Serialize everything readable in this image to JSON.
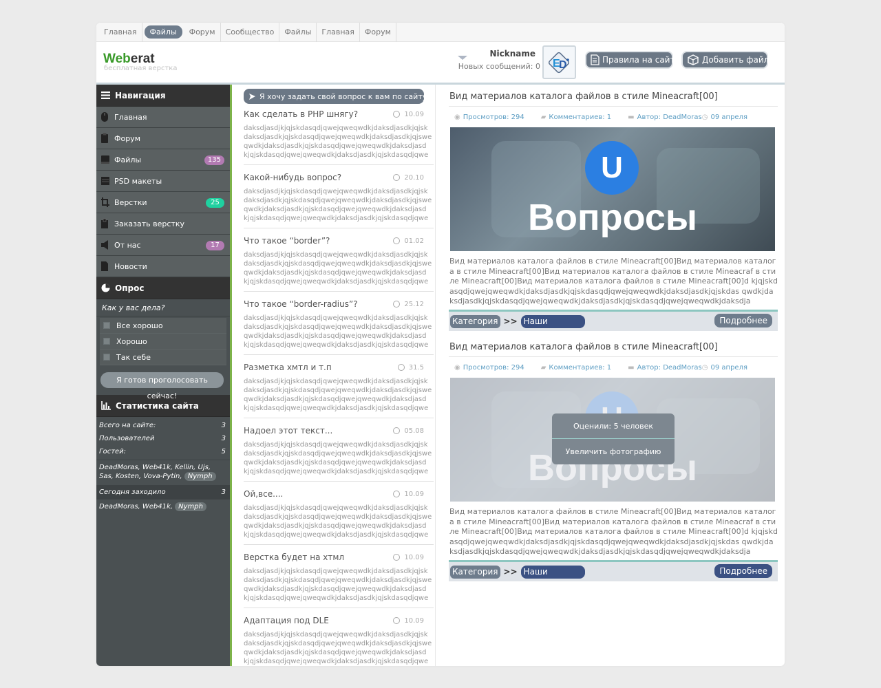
{
  "topnav": [
    "Главная",
    "Файлы",
    "Форум",
    "Сообщество",
    "Файлы",
    "Главная",
    "Форум"
  ],
  "topnav_active_index": 1,
  "logo": {
    "prefix": "Web",
    "suffix": "erat",
    "subtitle": "бесплатная верстка"
  },
  "user": {
    "nickname": "Nickname",
    "messages": "Новых сообщений: 0"
  },
  "header_buttons": {
    "rules": "Правила на сайте",
    "add_file": "Добавить файл"
  },
  "sidebar": {
    "nav_title": "Навигация",
    "items": [
      {
        "label": "Главная",
        "icon": "mouse-icon",
        "badge": ""
      },
      {
        "label": "Форум",
        "icon": "clipboard-icon",
        "badge": ""
      },
      {
        "label": "Файлы",
        "icon": "drive-icon",
        "badge": "135",
        "badge_color": "#b27ab2"
      },
      {
        "label": "PSD макеты",
        "icon": "layers-icon",
        "badge": ""
      },
      {
        "label": "Верстки",
        "icon": "crop-icon",
        "badge": "25",
        "badge_color": "#1fd1a0"
      },
      {
        "label": "Заказать верстку",
        "icon": "order-icon",
        "badge": ""
      },
      {
        "label": "От нас",
        "icon": "speaker-icon",
        "badge": "17",
        "badge_color": "#b27ab2"
      },
      {
        "label": "Новости",
        "icon": "document-icon",
        "badge": ""
      }
    ],
    "poll_title": "Опрос",
    "poll_question": "Как у вас дела?",
    "poll_options": [
      "Все хорошо",
      "Хорошо",
      "Так себе"
    ],
    "vote_button": "Я готов проголосовать сейчас!",
    "stats_title": "Статистика сайта",
    "stats": [
      {
        "label": "Всего на сайте:",
        "value": "3"
      },
      {
        "label": "Пользователей",
        "value": "3"
      },
      {
        "label": "Гостей:",
        "value": "5"
      }
    ],
    "online_users": "DeadMoras, Web41k, Kellin, Ujs, Sas, Kosten, Vova-Pytin,",
    "online_pill": "Nymph",
    "today_label": "Сегодня заходило",
    "today_value": "3",
    "today_users": "DeadMoras, Web41k,",
    "today_pill": "Nymph"
  },
  "ask_button": "Я хочу задать  свой вопрос к вам по сайту",
  "questions": [
    {
      "title": "Как сделать в PHP шнягу?",
      "date": "10.09"
    },
    {
      "title": "Какой-нибудь вопрос?",
      "date": "20.10"
    },
    {
      "title": "Что такое “border”?",
      "date": "01.02"
    },
    {
      "title": "Что такое “border-radius”?",
      "date": "25.12"
    },
    {
      "title": "Разметка хмтл и т.п",
      "date": "31.5"
    },
    {
      "title": "Надоел этот текст...",
      "date": "05.08"
    },
    {
      "title": "Ой,все....",
      "date": "10.09"
    },
    {
      "title": "Верстка будет на хтмл",
      "date": "10.09"
    },
    {
      "title": "Адаптация под DLE",
      "date": "10.09"
    }
  ],
  "question_text": "daksdjasdjkjqjskdasqdjqwejqweqwdkjdaksdjasdkjqjsk\ndaksdjasdkjqjskdasqdjqwejqweqwdkjdaksdjasdkjqjswe\nqwdkjdaksdjasdkjqjskdasqdjqwejqweqwdkjdaksdjasd\nkjqjskdasqdjqwejqweqwdkjdaksdjasdkjqjskdasqdjqwe",
  "articles": [
    {
      "title": "Вид материалов каталога файлов в стиле Mineacraft[00]",
      "views": "Просмотров: 294",
      "comments": "Комментариев: 1",
      "author": "Автор: DeadMoras",
      "date": "09 апреля",
      "image_word": "Вопросы",
      "image_letter": "U",
      "text": "Вид материалов каталога файлов в стиле Mineacraft[00]Вид материалов каталога в стиле Mineacraft[00]Вид материалов каталога файлов в стиле Mineacraf в стиле Mineacraft[00]Вид материалов каталога файлов в стиле Mineacraft[00]d kjqjskdasqdjqwejqweqwdkjdaksdjasdkjqjskdasqdjqwejqweqwdkjdaksdjasdkjqjskdas qwdkjdaksdjasdkjqjskdasqdjqwejqweqwdkjdaksdjasdkjqjskdasqdjqwejqweqwdkjdaksdja",
      "category": "Категория",
      "arrows": ">>",
      "subcategory": "Наши верстки",
      "more": "Подробнее"
    },
    {
      "title": "Вид материалов каталога файлов в стиле Mineacraft[00]",
      "views": "Просмотров: 294",
      "comments": "Комментариев: 1",
      "author": "Автор: DeadMoras",
      "date": "09 апреля",
      "image_word": "Вопросы",
      "image_letter": "U",
      "overlay_rating": "Оценили: 5 человек",
      "overlay_zoom": "Увеличить фотографию",
      "text": "Вид материалов каталога файлов в стиле Mineacraft[00]Вид материалов каталога в стиле Mineacraft[00]Вид материалов каталога файлов в стиле Mineacraf в стиле Mineacraft[00]Вид материалов каталога файлов в стиле Mineacraft[00]d kjqjskdasqdjqwejqweqwdkjdaksdjasdkjqjskdasqdjqwejqweqwdkjdaksdjasdkjqjskdas qwdkjdaksdjasdkjqjskdasqdjqwejqweqwdkjdaksdjasdkjqjskdasqdjqwejqweqwdkjdaksdja",
      "category": "Категория",
      "arrows": ">>",
      "subcategory": "Наши верстки",
      "more": "Подробнее"
    }
  ]
}
